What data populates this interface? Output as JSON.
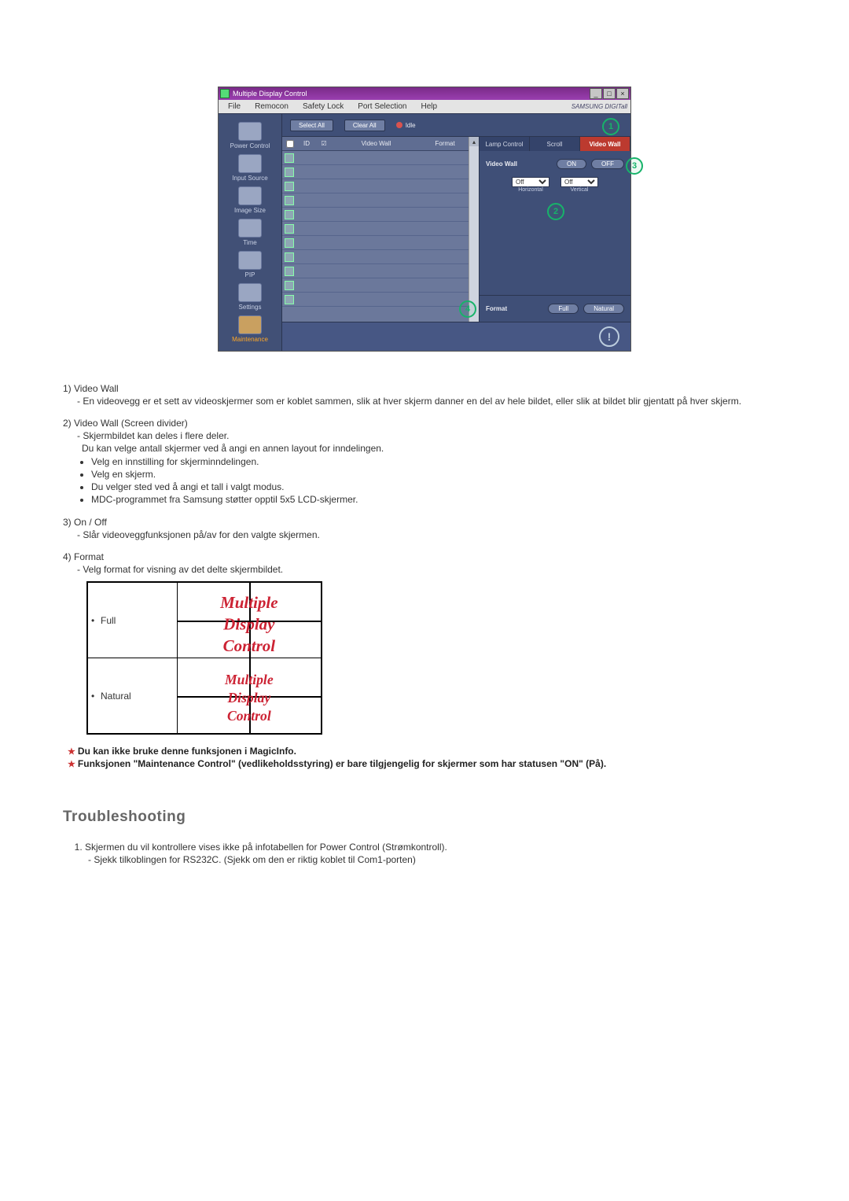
{
  "app": {
    "title": "Multiple Display Control",
    "winbuttons": {
      "min": "_",
      "max": "□",
      "close": "×"
    },
    "menu": [
      "File",
      "Remocon",
      "Safety Lock",
      "Port Selection",
      "Help"
    ],
    "brand": "SAMSUNG DIGITall",
    "toolbar": {
      "select_all": "Select All",
      "clear_all": "Clear All",
      "idle": "Idle"
    },
    "leftnav": [
      "Power Control",
      "Input Source",
      "Image Size",
      "Time",
      "PIP",
      "Settings",
      "Maintenance"
    ],
    "table": {
      "head_id": "ID",
      "head_vw": "Video Wall",
      "head_fmt": "Format",
      "rows": 11
    },
    "right": {
      "tabs": [
        "Lamp Control",
        "Scroll",
        "Video Wall"
      ],
      "vw_label": "Video Wall",
      "on": "ON",
      "off": "OFF",
      "h_val": "Off",
      "v_val": "Off",
      "h_lbl": "Horizontal",
      "v_lbl": "Vertical",
      "fmt_label": "Format",
      "full": "Full",
      "natural": "Natural"
    }
  },
  "callouts": {
    "c1": "1",
    "c2": "2",
    "c3": "3",
    "c4": "4"
  },
  "doc": {
    "i1_num": "1)",
    "i1_title": "Video Wall",
    "i1_sub": "- En videovegg er et sett av videoskjermer som er koblet sammen, slik at hver skjerm danner en del av hele bildet, eller slik at bildet blir gjentatt på hver skjerm.",
    "i2_num": "2)",
    "i2_title": "Video Wall (Screen divider)",
    "i2_sub1": "- Skjermbildet kan deles i flere deler.",
    "i2_sub2": "Du kan velge antall skjermer ved å angi en annen layout for inndelingen.",
    "i2_b": [
      "Velg en innstilling for skjerminndelingen.",
      "Velg en skjerm.",
      "Du velger sted ved å angi et tall i valgt modus.",
      "MDC-programmet fra Samsung støtter opptil 5x5 LCD-skjermer."
    ],
    "i3_num": "3)",
    "i3_title": "On / Off",
    "i3_sub": "- Slår videoveggfunksjonen på/av for den valgte skjermen.",
    "i4_num": "4)",
    "i4_title": "Format",
    "i4_sub": "- Velg format for visning av det delte skjermbildet.",
    "fmt_full": "Full",
    "fmt_natural": "Natural",
    "gfx1": "Multiple",
    "gfx2": "Display",
    "gfx3": "Control",
    "star1": "Du kan ikke bruke denne funksjonen i MagicInfo.",
    "star2": "Funksjonen \"Maintenance Control\" (vedlikeholdsstyring) er bare tilgjengelig for skjermer som har statusen \"ON\" (På).",
    "troubleshoot": "Troubleshooting",
    "t1": "Skjermen du vil kontrollere vises ikke på infotabellen for Power Control (Strømkontroll).",
    "t1_sub": "- Sjekk tilkoblingen for RS232C. (Sjekk om den er riktig koblet til Com1-porten)"
  }
}
